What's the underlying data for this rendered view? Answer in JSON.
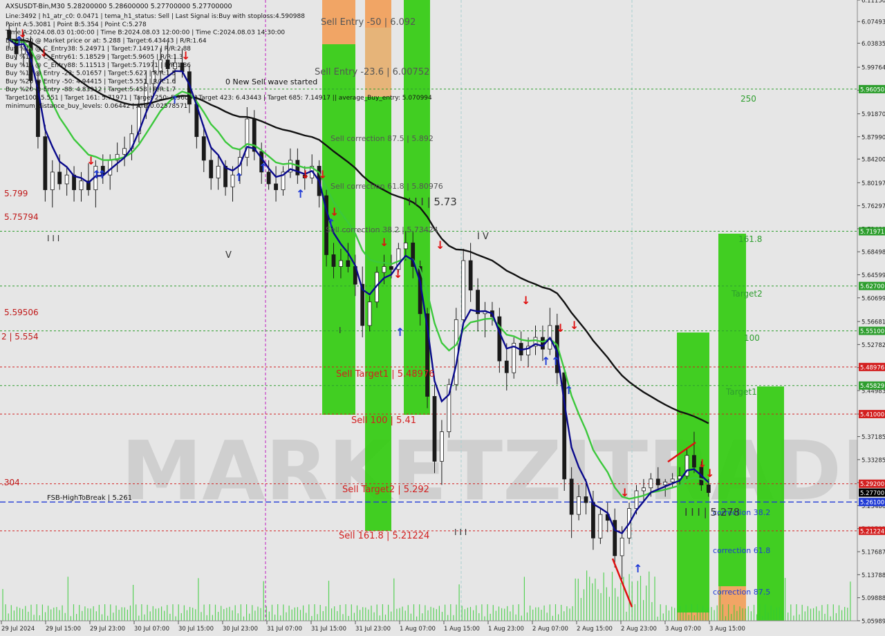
{
  "chart_data": {
    "type": "candlestick",
    "symbol": "AXSUSDT-Bin,M30",
    "ohlc_header": "5.28200000 5.28600000 5.27700000 5.27700000",
    "info_lines": [
      "Line:3492 | h1_atr_c0: 0.0471 | tema_h1_status: Sell | Last Signal is:Buy with stoploss:4.590988",
      "Point A:5.3081 | Point B:5.354 | Point C:5.278",
      "Time A:2024.08.03 01:00:00 | Time B:2024.08.03 12:00:00 | Time C:2024.08.03 14:30:00",
      "Buy %20 @ Market price or at: 5.288 | Target:6.43443 | R/R:1.64",
      "Buy %10 @ C_Entry38: 5.24971 | Target:7.14917 | R/R:2.88",
      "Buy %10 @ C_Entry61: 5.18529 | Target:5.9605 | R/R:1.3",
      "Buy %10 @ C_Entry88: 5.11513 | Target:5.71971 | R/R:1.86",
      "Buy %10 @ Entry -23: 5.01657 | Target:5.627 | R/R:1.5",
      "Buy %20 @ Entry -50: 4.94415 | Target:5.551 | R/R:1.6",
      "Buy %20 @ Entry -88: 4.83912 | Target:5.458 | R/R:1.7",
      "Target100: 5.551 | Target 161: 5.71971 | Target 250: 5.9605 | Target 423: 6.43443 | Target 685: 7.14917 || average_Buy_entry: 5.070994",
      "minimum_distance_buy_levels: 0.06442 | ATR:0.02578571"
    ],
    "ylim": [
      5.0598,
      6.1115
    ],
    "y_ticks": [
      "6.11150",
      "6.07493",
      "6.03835",
      "5.99764",
      "5.95870",
      "5.91870",
      "5.87990",
      "5.84200",
      "5.80197",
      "5.76297",
      "5.72400",
      "5.68498",
      "5.64599",
      "5.60699",
      "5.56681",
      "5.52782",
      "5.48882",
      "5.44983",
      "5.41000",
      "5.37185",
      "5.33285",
      "5.29386",
      "5.25486",
      "5.21592",
      "5.17687",
      "5.13788",
      "5.09888",
      "5.05989"
    ],
    "x_ticks": [
      "29 Jul 2024",
      "29 Jul 15:00",
      "29 Jul 23:00",
      "30 Jul 07:00",
      "30 Jul 15:00",
      "30 Jul 23:00",
      "31 Jul 07:00",
      "31 Jul 15:00",
      "31 Jul 23:00",
      "1 Aug 07:00",
      "1 Aug 15:00",
      "1 Aug 23:00",
      "2 Aug 07:00",
      "2 Aug 15:00",
      "2 Aug 23:00",
      "3 Aug 07:00",
      "3 Aug 15:00"
    ],
    "price_badges": [
      {
        "value": "5.96050",
        "color": "#2e9e2e"
      },
      {
        "value": "5.71971",
        "color": "#2e9e2e"
      },
      {
        "value": "5.62700",
        "color": "#2e9e2e"
      },
      {
        "value": "5.55100",
        "color": "#2e9e2e"
      },
      {
        "value": "5.48976",
        "color": "#d32020"
      },
      {
        "value": "5.45829",
        "color": "#2e9e2e"
      },
      {
        "value": "5.41000",
        "color": "#d32020"
      },
      {
        "value": "5.29200",
        "color": "#d32020"
      },
      {
        "value": "5.27700",
        "color": "#000000"
      },
      {
        "value": "5.26100",
        "color": "#1f3ad6"
      },
      {
        "value": "5.21224",
        "color": "#d32020"
      }
    ],
    "levels": [
      {
        "price": 5.9605,
        "color": "#2e9e2e",
        "label": "250"
      },
      {
        "price": 5.71971,
        "color": "#2e9e2e",
        "label": "161.8"
      },
      {
        "price": 5.627,
        "color": "#2e9e2e",
        "label": "Target2"
      },
      {
        "price": 5.551,
        "color": "#2e9e2e",
        "label": "100"
      },
      {
        "price": 5.48976,
        "color": "#d32020",
        "label": "Sell Target1 | 5.48976"
      },
      {
        "price": 5.45829,
        "color": "#2e9e2e",
        "label": "Target1"
      },
      {
        "price": 5.41,
        "color": "#d32020",
        "label": "Sell 100 | 5.41"
      },
      {
        "price": 5.292,
        "color": "#d32020",
        "label": "Sell Target2 | 5.292"
      },
      {
        "price": 5.21224,
        "color": "#d32020",
        "label": "Sell 161.8 | 5.21224"
      }
    ],
    "fsb_line": {
      "price": 5.261,
      "label": "FSB-HighToBreak | 5.261"
    },
    "left_labels": [
      "5.799",
      "5.75794",
      "5.59506",
      "2 | 5.554",
      ".304"
    ],
    "zone_labels": [
      "Sell Entry -50 | 6.092",
      "Sell Entry -23.6 | 6.00752",
      "Sell correction 87.5 | 5.892",
      "Sell correction 61.8 | 5.80976",
      "Sell correction 38.2 | 5.73424",
      "correction 38.2",
      "correction 61.8",
      "correction 87.5"
    ],
    "wave_labels": [
      "I I I",
      "V",
      "I I I | 5.73",
      "I V",
      "I",
      "I I I",
      "I I I | 5.278"
    ],
    "annotation": "0 New Sell wave started",
    "watermark": "MARKETZITRADE",
    "series": [
      {
        "name": "MA fast (blue)",
        "color": "#0a0a8c"
      },
      {
        "name": "MA mid (green)",
        "color": "#3cc83c"
      },
      {
        "name": "MA slow (black)",
        "color": "#111111"
      }
    ],
    "candles": [
      [
        6.06,
        6.07,
        6.03,
        6.045
      ],
      [
        6.045,
        6.065,
        6.01,
        6.02
      ],
      [
        6.02,
        6.055,
        6.0,
        6.04
      ],
      [
        6.04,
        6.05,
        5.96,
        5.975
      ],
      [
        5.975,
        5.99,
        5.86,
        5.88
      ],
      [
        5.88,
        5.9,
        5.77,
        5.79
      ],
      [
        5.79,
        5.84,
        5.76,
        5.82
      ],
      [
        5.82,
        5.85,
        5.79,
        5.8
      ],
      [
        5.8,
        5.83,
        5.78,
        5.815
      ],
      [
        5.815,
        5.83,
        5.77,
        5.79
      ],
      [
        5.79,
        5.82,
        5.77,
        5.805
      ],
      [
        5.805,
        5.835,
        5.78,
        5.79
      ],
      [
        5.79,
        5.84,
        5.76,
        5.83
      ],
      [
        5.83,
        5.85,
        5.8,
        5.815
      ],
      [
        5.815,
        5.85,
        5.79,
        5.84
      ],
      [
        5.84,
        5.87,
        5.82,
        5.85
      ],
      [
        5.85,
        5.88,
        5.83,
        5.86
      ],
      [
        5.86,
        5.9,
        5.84,
        5.885
      ],
      [
        5.885,
        5.95,
        5.87,
        5.93
      ],
      [
        5.93,
        5.99,
        5.91,
        5.97
      ],
      [
        5.97,
        6.01,
        5.95,
        5.99
      ],
      [
        5.99,
        6.03,
        5.97,
        6.01
      ],
      [
        6.01,
        6.04,
        5.985,
        5.995
      ],
      [
        5.995,
        6.02,
        5.97,
        6.005
      ],
      [
        6.005,
        6.03,
        5.98,
        5.99
      ],
      [
        5.99,
        6.0,
        5.92,
        5.935
      ],
      [
        5.935,
        5.95,
        5.86,
        5.88
      ],
      [
        5.88,
        5.9,
        5.82,
        5.84
      ],
      [
        5.84,
        5.86,
        5.79,
        5.81
      ],
      [
        5.81,
        5.85,
        5.79,
        5.83
      ],
      [
        5.83,
        5.84,
        5.78,
        5.795
      ],
      [
        5.795,
        5.83,
        5.77,
        5.815
      ],
      [
        5.815,
        5.86,
        5.8,
        5.845
      ],
      [
        5.845,
        5.93,
        5.83,
        5.91
      ],
      [
        5.91,
        5.925,
        5.84,
        5.855
      ],
      [
        5.855,
        5.87,
        5.8,
        5.82
      ],
      [
        5.82,
        5.84,
        5.79,
        5.8
      ],
      [
        5.8,
        5.83,
        5.77,
        5.79
      ],
      [
        5.79,
        5.83,
        5.78,
        5.82
      ],
      [
        5.82,
        5.86,
        5.81,
        5.84
      ],
      [
        5.84,
        5.86,
        5.8,
        5.815
      ],
      [
        5.815,
        5.83,
        5.79,
        5.81
      ],
      [
        5.81,
        5.85,
        5.8,
        5.83
      ],
      [
        5.83,
        5.84,
        5.76,
        5.78
      ],
      [
        5.78,
        5.79,
        5.66,
        5.68
      ],
      [
        5.68,
        5.7,
        5.64,
        5.66
      ],
      [
        5.66,
        5.69,
        5.64,
        5.67
      ],
      [
        5.67,
        5.7,
        5.65,
        5.66
      ],
      [
        5.66,
        5.68,
        5.61,
        5.63
      ],
      [
        5.63,
        5.66,
        5.54,
        5.56
      ],
      [
        5.56,
        5.61,
        5.55,
        5.6
      ],
      [
        5.6,
        5.66,
        5.59,
        5.65
      ],
      [
        5.65,
        5.68,
        5.63,
        5.66
      ],
      [
        5.66,
        5.68,
        5.64,
        5.655
      ],
      [
        5.655,
        5.7,
        5.65,
        5.69
      ],
      [
        5.69,
        5.72,
        5.67,
        5.7
      ],
      [
        5.7,
        5.72,
        5.64,
        5.66
      ],
      [
        5.66,
        5.67,
        5.56,
        5.58
      ],
      [
        5.58,
        5.59,
        5.42,
        5.44
      ],
      [
        5.44,
        5.46,
        5.31,
        5.33
      ],
      [
        5.33,
        5.4,
        5.29,
        5.38
      ],
      [
        5.38,
        5.47,
        5.37,
        5.46
      ],
      [
        5.46,
        5.59,
        5.45,
        5.57
      ],
      [
        5.57,
        5.69,
        5.56,
        5.67
      ],
      [
        5.67,
        5.7,
        5.6,
        5.62
      ],
      [
        5.62,
        5.64,
        5.55,
        5.58
      ],
      [
        5.58,
        5.6,
        5.54,
        5.585
      ],
      [
        5.585,
        5.6,
        5.56,
        5.575
      ],
      [
        5.575,
        5.59,
        5.48,
        5.5
      ],
      [
        5.5,
        5.53,
        5.45,
        5.48
      ],
      [
        5.48,
        5.54,
        5.47,
        5.53
      ],
      [
        5.53,
        5.55,
        5.5,
        5.51
      ],
      [
        5.51,
        5.54,
        5.49,
        5.525
      ],
      [
        5.525,
        5.56,
        5.51,
        5.54
      ],
      [
        5.54,
        5.56,
        5.5,
        5.52
      ],
      [
        5.52,
        5.59,
        5.51,
        5.56
      ],
      [
        5.56,
        5.58,
        5.46,
        5.48
      ],
      [
        5.48,
        5.49,
        5.28,
        5.3
      ],
      [
        5.3,
        5.32,
        5.2,
        5.24
      ],
      [
        5.24,
        5.29,
        5.23,
        5.27
      ],
      [
        5.27,
        5.3,
        5.24,
        5.26
      ],
      [
        5.26,
        5.28,
        5.18,
        5.2
      ],
      [
        5.2,
        5.25,
        5.19,
        5.24
      ],
      [
        5.24,
        5.26,
        5.21,
        5.23
      ],
      [
        5.23,
        5.25,
        5.15,
        5.17
      ],
      [
        5.17,
        5.22,
        5.13,
        5.2
      ],
      [
        5.2,
        5.26,
        5.19,
        5.25
      ],
      [
        5.25,
        5.29,
        5.24,
        5.28
      ],
      [
        5.28,
        5.3,
        5.26,
        5.285
      ],
      [
        5.285,
        5.31,
        5.27,
        5.3
      ],
      [
        5.3,
        5.32,
        5.28,
        5.29
      ],
      [
        5.29,
        5.3,
        5.27,
        5.295
      ],
      [
        5.295,
        5.31,
        5.285,
        5.3
      ],
      [
        5.3,
        5.32,
        5.29,
        5.305
      ],
      [
        5.305,
        5.35,
        5.3,
        5.34
      ],
      [
        5.34,
        5.38,
        5.31,
        5.32
      ],
      [
        5.32,
        5.33,
        5.28,
        5.29
      ],
      [
        5.29,
        5.3,
        5.27,
        5.277
      ]
    ],
    "volume_note": "volume bars shown along the bottom"
  },
  "colors": {
    "background": "#e6e6e6",
    "bull": "#1a1a1a",
    "bear": "#1a1a1a",
    "green_zone": "#33cc11",
    "orange_zone": "#f2a05a",
    "red_level": "#d32020",
    "green_level": "#2e9e2e",
    "blue": "#1f3ad6",
    "volume": "#33cc33"
  }
}
